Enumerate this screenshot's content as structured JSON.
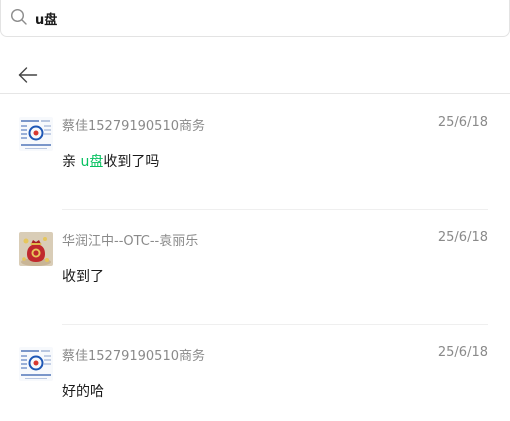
{
  "search": {
    "value": "u盘",
    "icon": "search-icon"
  },
  "header": {
    "back_icon": "back-arrow-icon"
  },
  "colors": {
    "highlight": "#07c160",
    "meta_text": "#8a8a8a",
    "divider": "#efefef"
  },
  "results": [
    {
      "sender": "蔡佳15279190510商务",
      "date": "25/6/18",
      "message_before": "亲 ",
      "message_match": "u盘",
      "message_after": "收到了吗",
      "avatar": "business-card-avatar"
    },
    {
      "sender": "华润江中--OTC--袁丽乐",
      "date": "25/6/18",
      "message_before": "收到了",
      "message_match": "",
      "message_after": "",
      "avatar": "red-fortune-bag-avatar"
    },
    {
      "sender": "蔡佳15279190510商务",
      "date": "25/6/18",
      "message_before": "好的哈",
      "message_match": "",
      "message_after": "",
      "avatar": "business-card-avatar"
    }
  ]
}
